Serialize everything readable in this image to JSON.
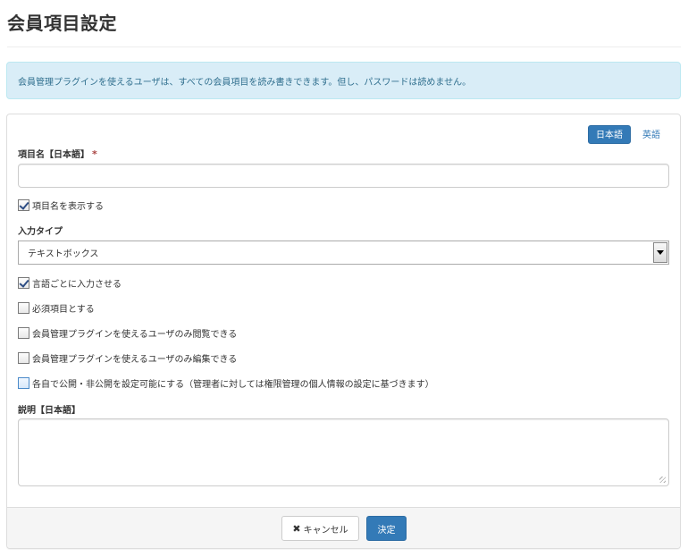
{
  "page": {
    "title": "会員項目設定",
    "info": "会員管理プラグインを使えるユーザは、すべての会員項目を読み書きできます。但し、パスワードは読めません。"
  },
  "lang": {
    "ja": "日本語",
    "en": "英語"
  },
  "form": {
    "item_name_label": "項目名【日本語】",
    "required_mark": "*",
    "item_name_value": "",
    "show_item_name": {
      "label": "項目名を表示する",
      "checked": true
    },
    "input_type_label": "入力タイプ",
    "input_type_value": "テキストボックス",
    "checkboxes": [
      {
        "label": "言語ごとに入力させる",
        "checked": true
      },
      {
        "label": "必須項目とする",
        "checked": false
      },
      {
        "label": "会員管理プラグインを使えるユーザのみ閲覧できる",
        "checked": false
      },
      {
        "label": "会員管理プラグインを使えるユーザのみ編集できる",
        "checked": false
      },
      {
        "label": "各自で公開・非公開を設定可能にする（管理者に対しては権限管理の個人情報の設定に基づきます）",
        "checked": false
      }
    ],
    "description_label": "説明【日本語】",
    "description_value": ""
  },
  "footer": {
    "cancel_icon": "close-icon",
    "cancel_label": "キャンセル",
    "submit_label": "決定"
  },
  "colors": {
    "primary": "#337ab7",
    "info_bg": "#d9edf7",
    "info_text": "#31708f",
    "required": "#a94442"
  }
}
